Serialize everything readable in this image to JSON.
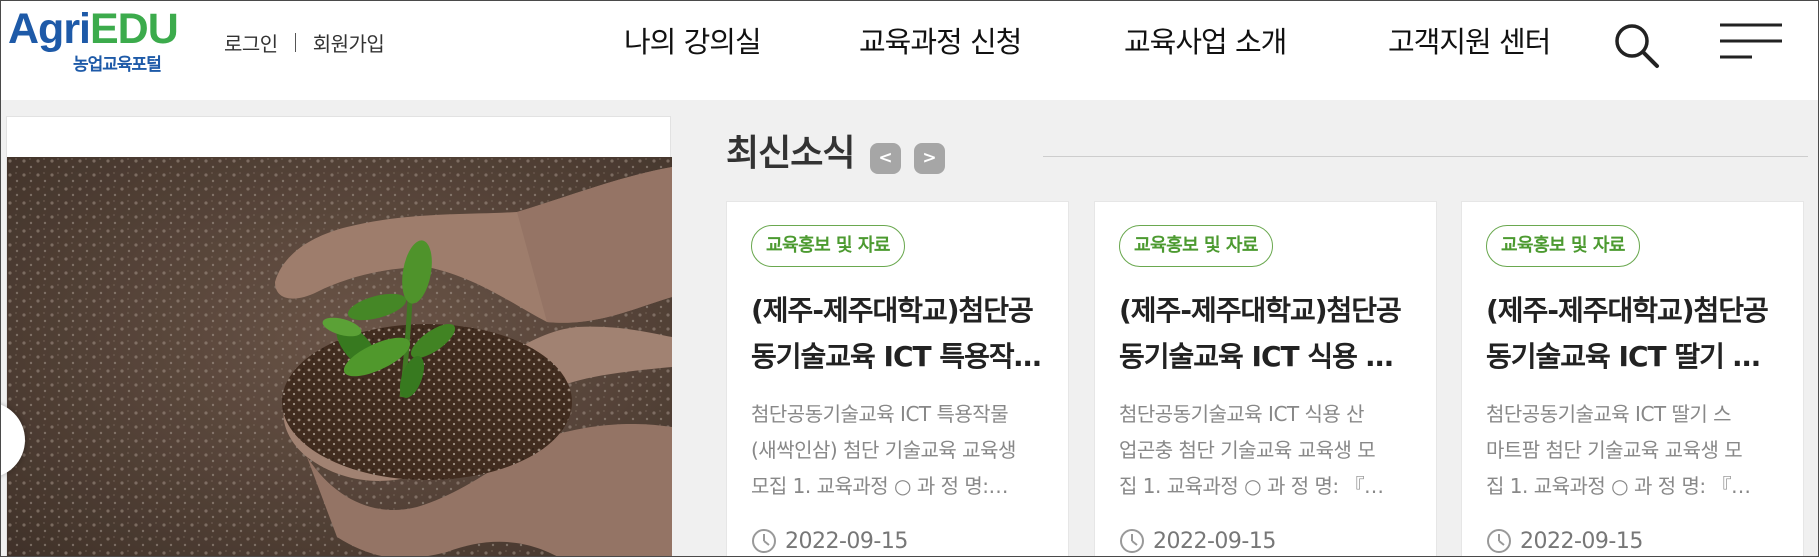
{
  "header": {
    "logo_main_a": "Agri",
    "logo_main_b": "EDU",
    "logo_sub": "농업교육포털",
    "login": "로그인",
    "signup": "회원가입",
    "nav": [
      "나의 강의실",
      "교육과정 신청",
      "교육사업 소개",
      "고객지원 센터"
    ],
    "search_icon": "search-icon",
    "menu_icon": "hamburger-menu-icon"
  },
  "banner": {
    "image": "hands-holding-soil-and-seedling",
    "prev_icon": "chevron-left-icon"
  },
  "news": {
    "title": "최신소식",
    "prev": "<",
    "next": ">",
    "cards": [
      {
        "badge": "교육홍보 및 자료",
        "title_line1": "(제주-제주대학교)첨단공",
        "title_line2": "동기술교육 ICT 특용작…",
        "desc_line1": "첨단공동기술교육 ICT  특용작물",
        "desc_line2": "(새싹인삼) 첨단 기술교육 교육생",
        "desc_line3": "모집 1. 교육과정 ○ 과 정 명:…",
        "date": "2022-09-15"
      },
      {
        "badge": "교육홍보 및 자료",
        "title_line1": "(제주-제주대학교)첨단공",
        "title_line2": "동기술교육 ICT 식용 …",
        "desc_line1": "첨단공동기술교육 ICT  식용 산",
        "desc_line2": "업곤충 첨단 기술교육 교육생 모",
        "desc_line3": "집 1. 교육과정 ○ 과 정 명: 『…",
        "date": "2022-09-15"
      },
      {
        "badge": "교육홍보 및 자료",
        "title_line1": "(제주-제주대학교)첨단공",
        "title_line2": "동기술교육 ICT 딸기 …",
        "desc_line1": "첨단공동기술교육 ICT  딸기 스",
        "desc_line2": "마트팜 첨단 기술교육 교육생 모",
        "desc_line3": "집 1. 교육과정 ○ 과 정 명: 『…",
        "date": "2022-09-15"
      }
    ]
  },
  "colors": {
    "brand_blue": "#1e5aa8",
    "brand_green": "#3cab4c",
    "badge_green": "#4c9a30"
  }
}
